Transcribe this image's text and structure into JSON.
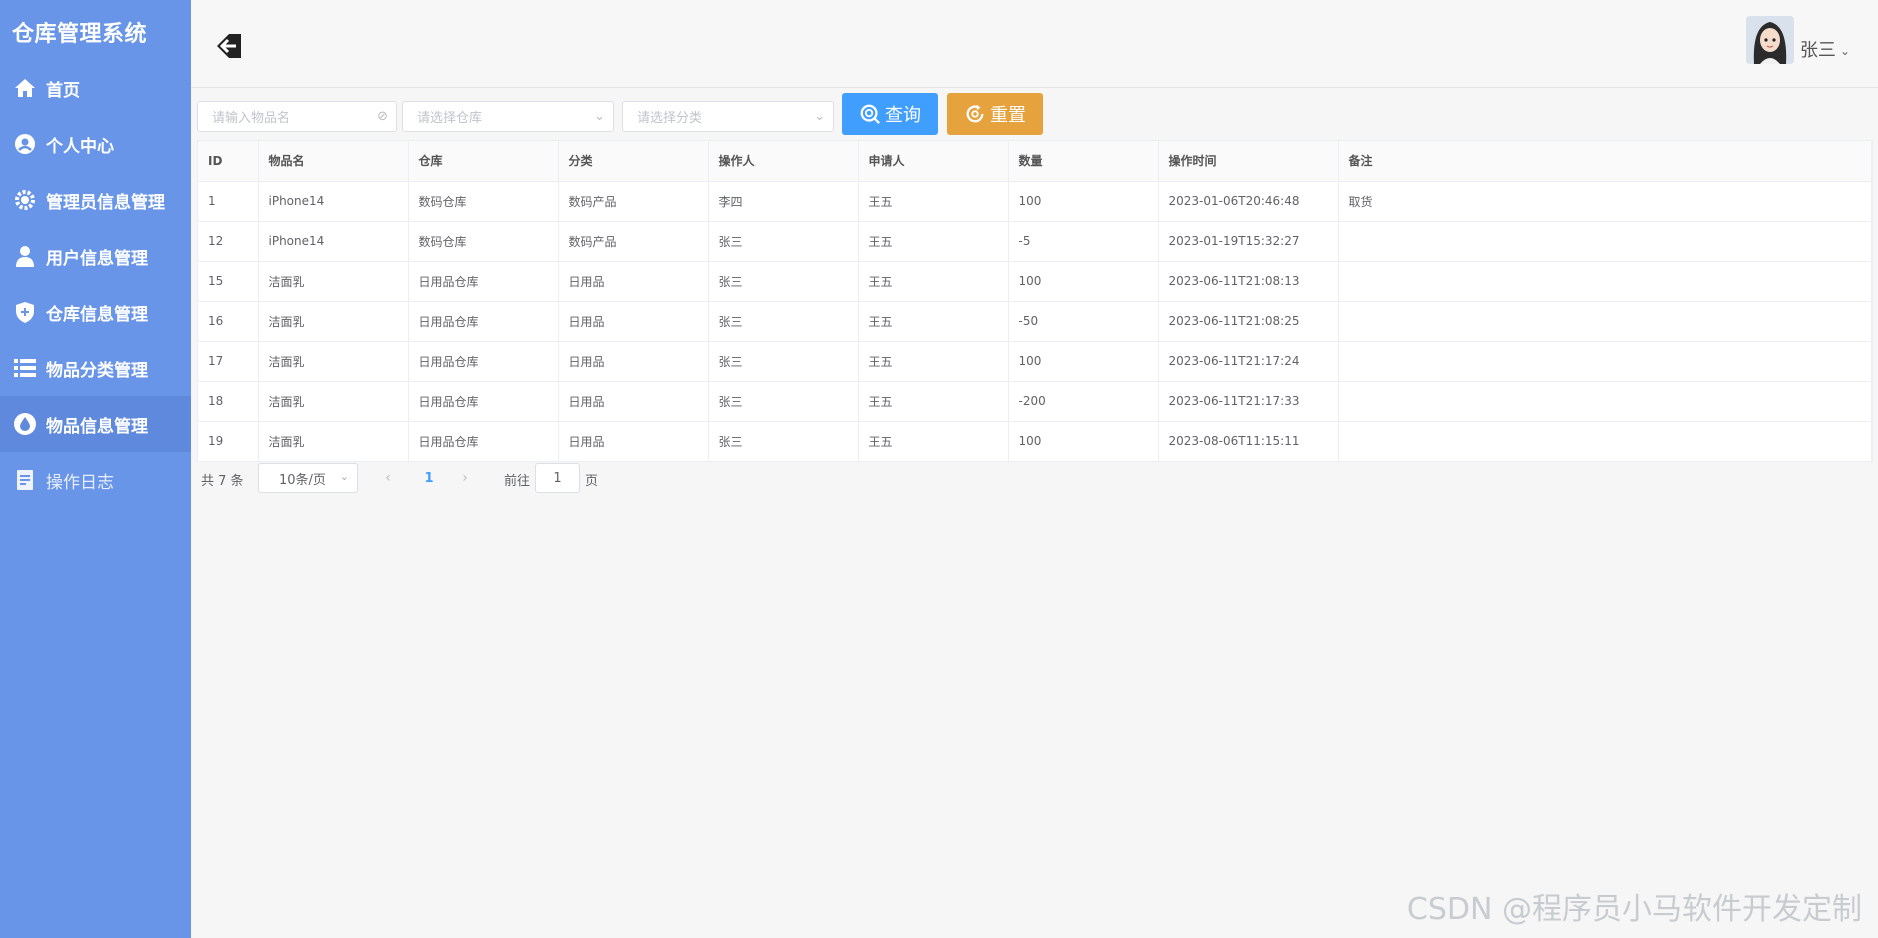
{
  "app": {
    "title": "仓库管理系统"
  },
  "menu": [
    {
      "label": "首页",
      "icon": "home-icon"
    },
    {
      "label": "个人中心",
      "icon": "user-circle-icon"
    },
    {
      "label": "管理员信息管理",
      "icon": "gear-icon"
    },
    {
      "label": "用户信息管理",
      "icon": "user-icon"
    },
    {
      "label": "仓库信息管理",
      "icon": "shield-icon"
    },
    {
      "label": "物品分类管理",
      "icon": "list-icon"
    },
    {
      "label": "物品信息管理",
      "icon": "drop-icon"
    },
    {
      "label": "操作日志",
      "icon": "document-icon"
    }
  ],
  "header": {
    "user_name": "张三",
    "back_icon": "back-arrow-icon",
    "avatar_icon": "avatar-icon"
  },
  "search": {
    "name_placeholder": "请输入物品名",
    "warehouse_placeholder": "请选择仓库",
    "category_placeholder": "请选择分类",
    "query_label": "查询",
    "reset_label": "重置"
  },
  "table": {
    "columns": [
      "ID",
      "物品名",
      "仓库",
      "分类",
      "操作人",
      "申请人",
      "数量",
      "操作时间",
      "备注"
    ],
    "rows": [
      [
        "1",
        "iPhone14",
        "数码仓库",
        "数码产品",
        "李四",
        "王五",
        "100",
        "2023-01-06T20:46:48",
        "取货"
      ],
      [
        "12",
        "iPhone14",
        "数码仓库",
        "数码产品",
        "张三",
        "王五",
        "-5",
        "2023-01-19T15:32:27",
        ""
      ],
      [
        "15",
        "洁面乳",
        "日用品仓库",
        "日用品",
        "张三",
        "王五",
        "100",
        "2023-06-11T21:08:13",
        ""
      ],
      [
        "16",
        "洁面乳",
        "日用品仓库",
        "日用品",
        "张三",
        "王五",
        "-50",
        "2023-06-11T21:08:25",
        ""
      ],
      [
        "17",
        "洁面乳",
        "日用品仓库",
        "日用品",
        "张三",
        "王五",
        "100",
        "2023-06-11T21:17:24",
        ""
      ],
      [
        "18",
        "洁面乳",
        "日用品仓库",
        "日用品",
        "张三",
        "王五",
        "-200",
        "2023-06-11T21:17:33",
        ""
      ],
      [
        "19",
        "洁面乳",
        "日用品仓库",
        "日用品",
        "张三",
        "王五",
        "100",
        "2023-08-06T11:15:11",
        ""
      ]
    ]
  },
  "pagination": {
    "total_label": "共 7 条",
    "page_size": "10条/页",
    "current_page": "1",
    "goto_label": "前往",
    "goto_value": "1",
    "goto_suffix": "页"
  },
  "watermark": "CSDN @程序员小马软件开发定制",
  "colors": {
    "sidebar": "#6895e8",
    "sidebar_active": "#5e89dc",
    "primary": "#409eff",
    "warning": "#e6a23c"
  }
}
